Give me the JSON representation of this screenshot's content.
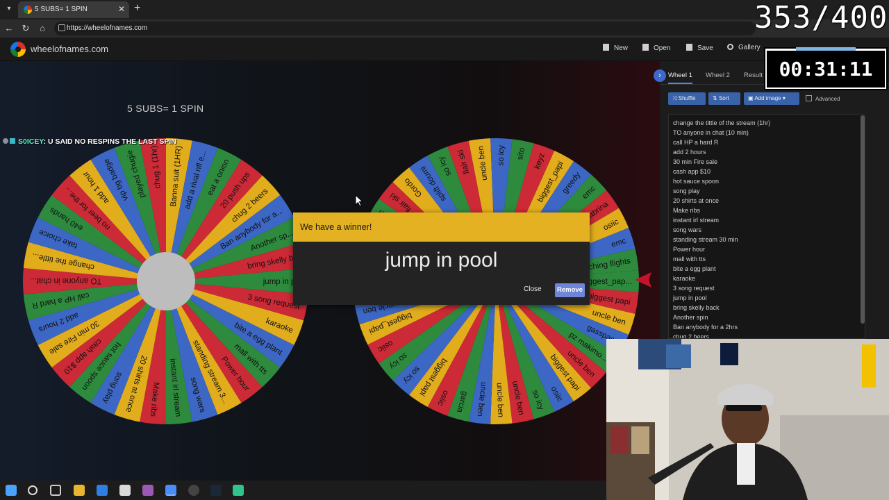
{
  "browser": {
    "tab_title": "5 SUBS= 1 SPIN",
    "url": "https://wheelofnames.com"
  },
  "site": {
    "name": "wheelofnames.com",
    "menu": [
      "New",
      "Open",
      "Save",
      "Gallery"
    ]
  },
  "overlay": {
    "counter": "353/400",
    "timer": "00:31:11",
    "title": "5 SUBS= 1 SPIN",
    "chat_user": "S0ICEY",
    "chat_message": ": U SAID NO RESPINS THE LAST SPIN"
  },
  "panel": {
    "tabs": [
      "Wheel 1",
      "Wheel 2",
      "Result"
    ],
    "buttons": {
      "shuffle": "Shuffle",
      "sort": "Sort",
      "add_image": "Add image",
      "advanced": "Advanced"
    },
    "entries": [
      "change the tittle of the stream (1hr)",
      "TO anyone in chat (10 min)",
      "call HP a hard R",
      "add 2 hours",
      "30 min Fire sale",
      "cash app $10",
      "hot sauce spoon",
      "song play",
      "20 shirts at once",
      "Make ribs",
      "instant irl stream",
      "song wars",
      "standing stream 30 min",
      "Power hour",
      "mall with tts",
      "bite a egg plant",
      "karaoke",
      "3 song request",
      "jump in pool",
      "bring skelly back",
      "Another spin",
      "Ban anybody for a 2hrs",
      "chug 2 beers"
    ]
  },
  "wheel1_labels": [
    "jump in p...",
    "3 song request",
    "karaoke",
    "bite a egg plant",
    "mall with tts",
    "Power hour",
    "standing stream 3...",
    "song wars",
    "instant irl stream",
    "Make ribs",
    "20 shirts at once",
    "song play",
    "hot sauce spoon",
    "cash app $10",
    "30 min Fire sale",
    "add 2 hours",
    "call HP a hard R",
    "TO anyone in chat...",
    "change the tittle...",
    "take choice",
    "e40 hands",
    "no beer for the...",
    "add 1 hour",
    "vip bg badge",
    "played chugie",
    "chug 1 (1hr)",
    "Banna suit (1HR)",
    "add a rival nfl e...",
    "eat a onion",
    "20 push ups",
    "chug 2 beers",
    "Ban anybody for a...",
    "Another sp...",
    "bring skelly b..."
  ],
  "wheel2_labels": [
    "biggest_pap...",
    "biggest papi",
    "uncle ben",
    "gasspacc",
    "pz makimo...",
    "uncle ben",
    "biggest papi",
    "osiic",
    "so icy",
    "uncle ben",
    "uncle ben",
    "uncle ben",
    "garcia",
    "osiic",
    "biggest papi",
    "so icy",
    "so icy",
    "osiic",
    "biggest_papi",
    "uncle ben",
    "uncle tr",
    "uncle ben",
    "solys",
    "gasspacc",
    "uncle ben",
    "flair ski",
    "Gordo",
    "splift doumi",
    "so icy",
    "flair ski",
    "uncle ben",
    "so icy",
    "sito",
    "keyz",
    "biggest_papi",
    "greedy",
    "emc",
    "sabrina",
    "osiic",
    "emc",
    "ching flights"
  ],
  "modal": {
    "title": "We have a winner!",
    "winner": "jump in pool",
    "close": "Close",
    "remove": "Remove"
  },
  "colors": {
    "segments": [
      "#2e8b3e",
      "#cc2a36",
      "#e2ad1c",
      "#3c67c4"
    ],
    "modal_header": "#e3b121",
    "accent": "#3e68c9"
  }
}
